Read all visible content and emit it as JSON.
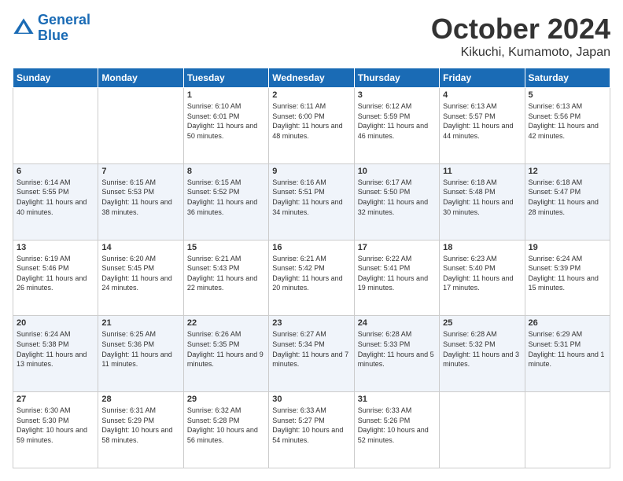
{
  "header": {
    "logo_line1": "General",
    "logo_line2": "Blue",
    "month": "October 2024",
    "location": "Kikuchi, Kumamoto, Japan"
  },
  "days_of_week": [
    "Sunday",
    "Monday",
    "Tuesday",
    "Wednesday",
    "Thursday",
    "Friday",
    "Saturday"
  ],
  "weeks": [
    [
      {
        "day": "",
        "sunrise": "",
        "sunset": "",
        "daylight": ""
      },
      {
        "day": "",
        "sunrise": "",
        "sunset": "",
        "daylight": ""
      },
      {
        "day": "1",
        "sunrise": "Sunrise: 6:10 AM",
        "sunset": "Sunset: 6:01 PM",
        "daylight": "Daylight: 11 hours and 50 minutes."
      },
      {
        "day": "2",
        "sunrise": "Sunrise: 6:11 AM",
        "sunset": "Sunset: 6:00 PM",
        "daylight": "Daylight: 11 hours and 48 minutes."
      },
      {
        "day": "3",
        "sunrise": "Sunrise: 6:12 AM",
        "sunset": "Sunset: 5:59 PM",
        "daylight": "Daylight: 11 hours and 46 minutes."
      },
      {
        "day": "4",
        "sunrise": "Sunrise: 6:13 AM",
        "sunset": "Sunset: 5:57 PM",
        "daylight": "Daylight: 11 hours and 44 minutes."
      },
      {
        "day": "5",
        "sunrise": "Sunrise: 6:13 AM",
        "sunset": "Sunset: 5:56 PM",
        "daylight": "Daylight: 11 hours and 42 minutes."
      }
    ],
    [
      {
        "day": "6",
        "sunrise": "Sunrise: 6:14 AM",
        "sunset": "Sunset: 5:55 PM",
        "daylight": "Daylight: 11 hours and 40 minutes."
      },
      {
        "day": "7",
        "sunrise": "Sunrise: 6:15 AM",
        "sunset": "Sunset: 5:53 PM",
        "daylight": "Daylight: 11 hours and 38 minutes."
      },
      {
        "day": "8",
        "sunrise": "Sunrise: 6:15 AM",
        "sunset": "Sunset: 5:52 PM",
        "daylight": "Daylight: 11 hours and 36 minutes."
      },
      {
        "day": "9",
        "sunrise": "Sunrise: 6:16 AM",
        "sunset": "Sunset: 5:51 PM",
        "daylight": "Daylight: 11 hours and 34 minutes."
      },
      {
        "day": "10",
        "sunrise": "Sunrise: 6:17 AM",
        "sunset": "Sunset: 5:50 PM",
        "daylight": "Daylight: 11 hours and 32 minutes."
      },
      {
        "day": "11",
        "sunrise": "Sunrise: 6:18 AM",
        "sunset": "Sunset: 5:48 PM",
        "daylight": "Daylight: 11 hours and 30 minutes."
      },
      {
        "day": "12",
        "sunrise": "Sunrise: 6:18 AM",
        "sunset": "Sunset: 5:47 PM",
        "daylight": "Daylight: 11 hours and 28 minutes."
      }
    ],
    [
      {
        "day": "13",
        "sunrise": "Sunrise: 6:19 AM",
        "sunset": "Sunset: 5:46 PM",
        "daylight": "Daylight: 11 hours and 26 minutes."
      },
      {
        "day": "14",
        "sunrise": "Sunrise: 6:20 AM",
        "sunset": "Sunset: 5:45 PM",
        "daylight": "Daylight: 11 hours and 24 minutes."
      },
      {
        "day": "15",
        "sunrise": "Sunrise: 6:21 AM",
        "sunset": "Sunset: 5:43 PM",
        "daylight": "Daylight: 11 hours and 22 minutes."
      },
      {
        "day": "16",
        "sunrise": "Sunrise: 6:21 AM",
        "sunset": "Sunset: 5:42 PM",
        "daylight": "Daylight: 11 hours and 20 minutes."
      },
      {
        "day": "17",
        "sunrise": "Sunrise: 6:22 AM",
        "sunset": "Sunset: 5:41 PM",
        "daylight": "Daylight: 11 hours and 19 minutes."
      },
      {
        "day": "18",
        "sunrise": "Sunrise: 6:23 AM",
        "sunset": "Sunset: 5:40 PM",
        "daylight": "Daylight: 11 hours and 17 minutes."
      },
      {
        "day": "19",
        "sunrise": "Sunrise: 6:24 AM",
        "sunset": "Sunset: 5:39 PM",
        "daylight": "Daylight: 11 hours and 15 minutes."
      }
    ],
    [
      {
        "day": "20",
        "sunrise": "Sunrise: 6:24 AM",
        "sunset": "Sunset: 5:38 PM",
        "daylight": "Daylight: 11 hours and 13 minutes."
      },
      {
        "day": "21",
        "sunrise": "Sunrise: 6:25 AM",
        "sunset": "Sunset: 5:36 PM",
        "daylight": "Daylight: 11 hours and 11 minutes."
      },
      {
        "day": "22",
        "sunrise": "Sunrise: 6:26 AM",
        "sunset": "Sunset: 5:35 PM",
        "daylight": "Daylight: 11 hours and 9 minutes."
      },
      {
        "day": "23",
        "sunrise": "Sunrise: 6:27 AM",
        "sunset": "Sunset: 5:34 PM",
        "daylight": "Daylight: 11 hours and 7 minutes."
      },
      {
        "day": "24",
        "sunrise": "Sunrise: 6:28 AM",
        "sunset": "Sunset: 5:33 PM",
        "daylight": "Daylight: 11 hours and 5 minutes."
      },
      {
        "day": "25",
        "sunrise": "Sunrise: 6:28 AM",
        "sunset": "Sunset: 5:32 PM",
        "daylight": "Daylight: 11 hours and 3 minutes."
      },
      {
        "day": "26",
        "sunrise": "Sunrise: 6:29 AM",
        "sunset": "Sunset: 5:31 PM",
        "daylight": "Daylight: 11 hours and 1 minute."
      }
    ],
    [
      {
        "day": "27",
        "sunrise": "Sunrise: 6:30 AM",
        "sunset": "Sunset: 5:30 PM",
        "daylight": "Daylight: 10 hours and 59 minutes."
      },
      {
        "day": "28",
        "sunrise": "Sunrise: 6:31 AM",
        "sunset": "Sunset: 5:29 PM",
        "daylight": "Daylight: 10 hours and 58 minutes."
      },
      {
        "day": "29",
        "sunrise": "Sunrise: 6:32 AM",
        "sunset": "Sunset: 5:28 PM",
        "daylight": "Daylight: 10 hours and 56 minutes."
      },
      {
        "day": "30",
        "sunrise": "Sunrise: 6:33 AM",
        "sunset": "Sunset: 5:27 PM",
        "daylight": "Daylight: 10 hours and 54 minutes."
      },
      {
        "day": "31",
        "sunrise": "Sunrise: 6:33 AM",
        "sunset": "Sunset: 5:26 PM",
        "daylight": "Daylight: 10 hours and 52 minutes."
      },
      {
        "day": "",
        "sunrise": "",
        "sunset": "",
        "daylight": ""
      },
      {
        "day": "",
        "sunrise": "",
        "sunset": "",
        "daylight": ""
      }
    ]
  ]
}
